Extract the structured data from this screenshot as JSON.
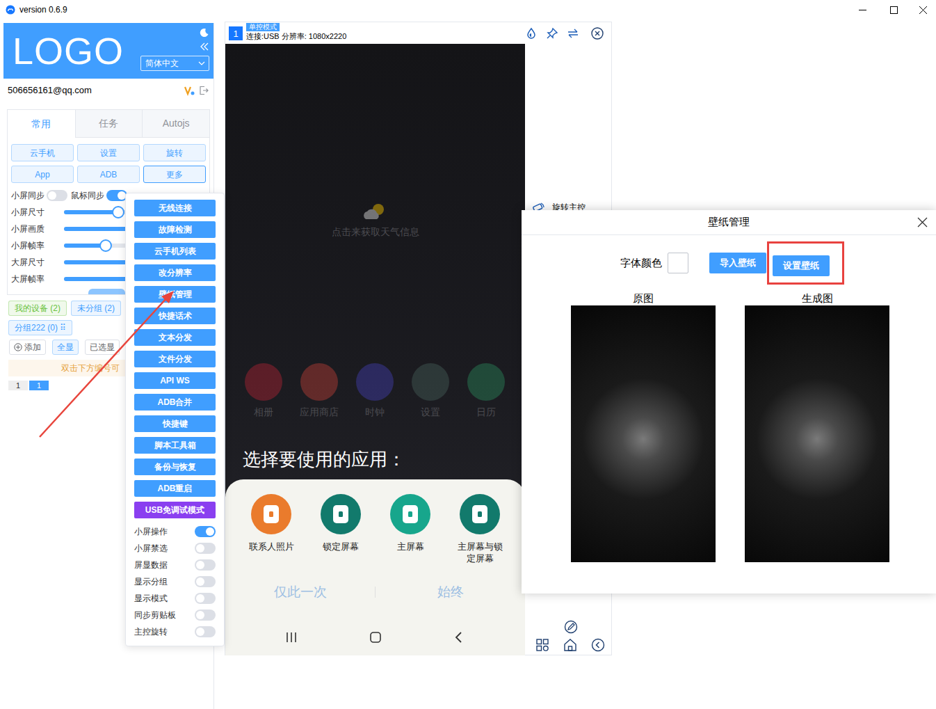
{
  "window": {
    "title": "version 0.6.9"
  },
  "sidebar": {
    "logo": "LOGO",
    "language": "简体中文",
    "account": "506656161@qq.com",
    "tabs": [
      {
        "label": "常用",
        "selected": true
      },
      {
        "label": "任务",
        "selected": false
      },
      {
        "label": "Autojs",
        "selected": false
      }
    ],
    "buttons": [
      {
        "label": "云手机",
        "selected": false
      },
      {
        "label": "设置",
        "selected": false
      },
      {
        "label": "旋转",
        "selected": false
      },
      {
        "label": "App",
        "selected": false
      },
      {
        "label": "ADB",
        "selected": false
      },
      {
        "label": "更多",
        "selected": true
      }
    ],
    "toggles": [
      {
        "label": "小屏同步",
        "on": false
      },
      {
        "label": "鼠标同步",
        "on": true
      }
    ],
    "sliders": [
      {
        "label": "小屏尺寸",
        "level": 0.39
      },
      {
        "label": "小屏画质",
        "level": 0.6
      },
      {
        "label": "小屏帧率",
        "level": 0.3
      },
      {
        "label": "大屏尺寸",
        "level": 0.6
      },
      {
        "label": "大屏帧率",
        "level": 0.6
      }
    ],
    "groups": [
      {
        "label": "我的设备 (2)",
        "color": "#67c23a"
      },
      {
        "label": "未分组 (2)",
        "color": "#409eff"
      },
      {
        "label": "分组222 (0) ⠿",
        "color": "#409eff"
      }
    ],
    "group_actions": [
      {
        "label": "添加",
        "selected": false
      },
      {
        "label": "全显",
        "selected": true
      },
      {
        "label": "已选显",
        "selected": false
      }
    ],
    "notice": "双击下方编号可",
    "pages": [
      {
        "label": "1",
        "selected": false
      },
      {
        "label": "1",
        "selected": true
      }
    ]
  },
  "menu": {
    "items": [
      {
        "kind": "button",
        "label": "无线连接",
        "color": "#409eff"
      },
      {
        "kind": "button",
        "label": "故障检测",
        "color": "#409eff"
      },
      {
        "kind": "button",
        "label": "云手机列表",
        "color": "#409eff"
      },
      {
        "kind": "button",
        "label": "改分辨率",
        "color": "#409eff"
      },
      {
        "kind": "button",
        "label": "壁纸管理",
        "color": "#409eff"
      },
      {
        "kind": "button",
        "label": "快捷话术",
        "color": "#409eff"
      },
      {
        "kind": "button",
        "label": "文本分发",
        "color": "#409eff"
      },
      {
        "kind": "button",
        "label": "文件分发",
        "color": "#409eff"
      },
      {
        "kind": "button",
        "label": "API WS",
        "color": "#409eff"
      },
      {
        "kind": "button",
        "label": "ADB合并",
        "color": "#409eff"
      },
      {
        "kind": "button",
        "label": "快捷键",
        "color": "#409eff"
      },
      {
        "kind": "button",
        "label": "脚本工具箱",
        "color": "#409eff"
      },
      {
        "kind": "button",
        "label": "备份与恢复",
        "color": "#409eff"
      },
      {
        "kind": "button",
        "label": "ADB重启",
        "color": "#409eff"
      },
      {
        "kind": "button",
        "label": "USB免调试模式",
        "color": "#8a3ff0"
      },
      {
        "kind": "toggle",
        "label": "小屏操作",
        "on": true
      },
      {
        "kind": "toggle",
        "label": "小屏禁选",
        "on": false
      },
      {
        "kind": "toggle",
        "label": "屏显数据",
        "on": false
      },
      {
        "kind": "toggle",
        "label": "显示分组",
        "on": false
      },
      {
        "kind": "toggle",
        "label": "显示模式",
        "on": false
      },
      {
        "kind": "toggle",
        "label": "同步剪贴板",
        "on": false
      },
      {
        "kind": "toggle",
        "label": "主控旋转",
        "on": false
      }
    ]
  },
  "device": {
    "number": "1",
    "mode": "单控模式",
    "info": "连接:USB 分辨率: 1080x2220",
    "rotate_label": "旋转主控"
  },
  "phone": {
    "weather": "点击来获取天气信息",
    "apps": [
      {
        "label": "相册",
        "color": "#d8253a"
      },
      {
        "label": "应用商店",
        "color": "#e8473c"
      },
      {
        "label": "时钟",
        "color": "#4c48d8"
      },
      {
        "label": "设置",
        "color": "#4f6f66"
      },
      {
        "label": "日历",
        "color": "#2fa36b"
      }
    ],
    "chooser": {
      "title": "选择要使用的应用：",
      "options": [
        {
          "label": "联系人照片",
          "color": "#ea7b2c"
        },
        {
          "label": "锁定屏幕",
          "color": "#127a6c"
        },
        {
          "label": "主屏幕",
          "color": "#17a68c"
        },
        {
          "label": "主屏幕与锁定屏幕",
          "color": "#127a6c"
        }
      ],
      "actions": [
        "仅此一次",
        "始终"
      ]
    }
  },
  "dialog": {
    "title": "壁纸管理",
    "font_color_label": "字体颜色",
    "font_color": "#ffffff",
    "buttons": [
      {
        "label": "导入壁纸",
        "highlighted": false
      },
      {
        "label": "设置壁纸",
        "highlighted": true
      }
    ],
    "previews": [
      {
        "label": "原图"
      },
      {
        "label": "生成图"
      }
    ]
  }
}
